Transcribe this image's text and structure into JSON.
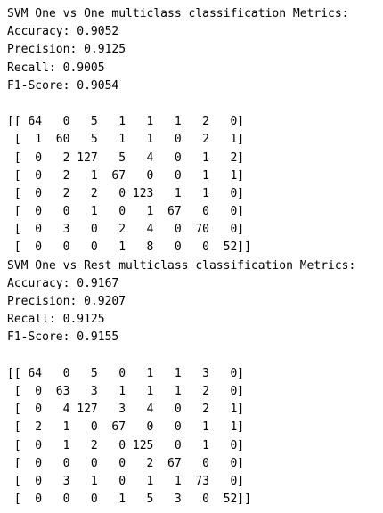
{
  "output": {
    "lines": [
      "SVM One vs One multiclass classification Metrics:",
      "Accuracy: 0.9052",
      "Precision: 0.9125",
      "Recall: 0.9005",
      "F1-Score: 0.9054",
      "",
      "[[ 64   0   5   1   1   1   2   0]",
      " [  1  60   5   1   1   0   2   1]",
      " [  0   2 127   5   4   0   1   2]",
      " [  0   2   1  67   0   0   1   1]",
      " [  0   2   2   0 123   1   1   0]",
      " [  0   0   1   0   1  67   0   0]",
      " [  0   3   0   2   4   0  70   0]",
      " [  0   0   0   1   8   0   0  52]]",
      "SVM One vs Rest multiclass classification Metrics:",
      "Accuracy: 0.9167",
      "Precision: 0.9207",
      "Recall: 0.9125",
      "F1-Score: 0.9155",
      "",
      "[[ 64   0   5   0   1   1   3   0]",
      " [  0  63   3   1   1   1   2   0]",
      " [  0   4 127   3   4   0   2   1]",
      " [  2   1   0  67   0   0   1   1]",
      " [  0   1   2   0 125   0   1   0]",
      " [  0   0   0   0   2  67   0   0]",
      " [  0   3   1   0   1   1  73   0]",
      " [  0   0   0   1   5   3   0  52]]"
    ]
  }
}
